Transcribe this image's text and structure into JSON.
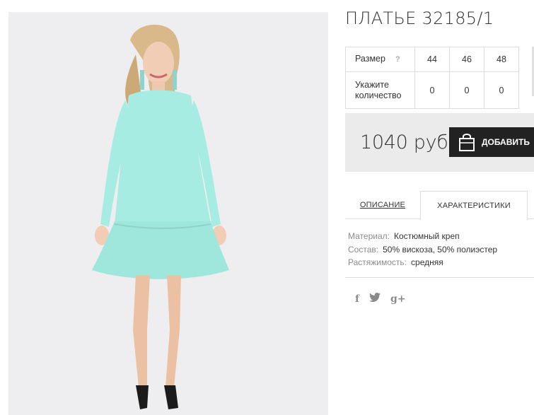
{
  "product": {
    "title": "ПЛАТЬЕ 32185/1",
    "image_alt": "mint dress on model"
  },
  "sizes": {
    "size_label": "Размер",
    "help_mark": "?",
    "values": [
      "44",
      "46",
      "48"
    ],
    "qty_label": "Укажите количество",
    "quantities": [
      "0",
      "0",
      "0"
    ]
  },
  "purchase": {
    "price": "1040 руб",
    "add_button_label": "ДОБАВИТЬ"
  },
  "tabs": {
    "description": "ОПИСАНИЕ",
    "characteristics": "ХАРАКТЕРИСТИКИ",
    "active": "characteristics"
  },
  "properties": [
    {
      "key": "Материал:",
      "value": "Костюмный креп"
    },
    {
      "key": "Состав:",
      "value": "50% вискоза, 50% полиэстер"
    },
    {
      "key": "Растяжимость:",
      "value": "средняя"
    }
  ],
  "social": {
    "facebook": "f",
    "twitter": "t",
    "googleplus": "g+"
  },
  "colors": {
    "dress": "#a6ece2",
    "photo_bg": "#eeeef0",
    "button_bg": "#222222",
    "price_bg": "#ebebeb"
  }
}
